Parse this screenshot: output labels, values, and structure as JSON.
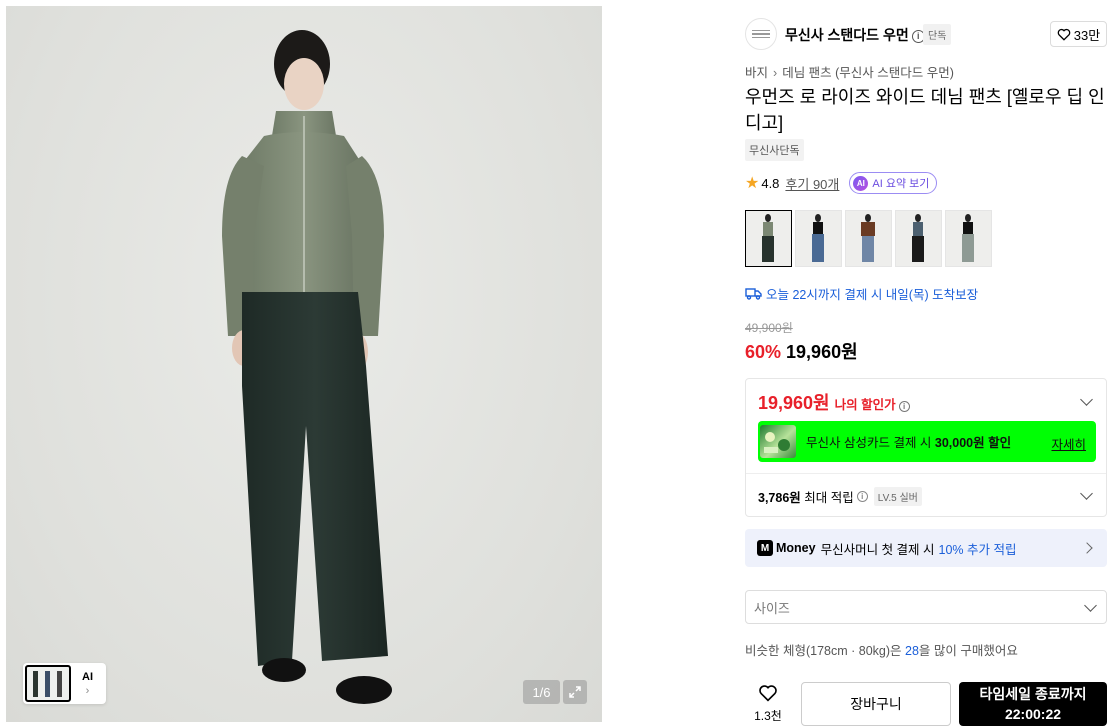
{
  "gallery": {
    "counter": "1/6",
    "ai_label": "AI"
  },
  "brand": {
    "name": "무신사 스탠다드 우먼",
    "badge": "단독",
    "like_count": "33만"
  },
  "breadcrumb": {
    "category": "바지",
    "subcategory": "데님 팬츠 (무신사 스탠다드 우먼)"
  },
  "product": {
    "title": "우먼즈 로 라이즈 와이드 데님 팬츠 [옐로우 딥 인디고]",
    "tag": "무신사단독",
    "rating": "4.8",
    "reviews": "후기 90개",
    "ai_summary": "AI 요약 보기",
    "delivery": "오늘 22시까지 결제 시 내일(목) 도착보장",
    "original_price": "49,900원",
    "discount": "60%",
    "sale_price": "19,960원"
  },
  "benefit": {
    "my_price": "19,960원",
    "my_price_label": "나의 할인가",
    "card_text_prefix": "무신사 삼성카드 결제 시 ",
    "card_text_bold": "30,000원 할인",
    "card_more": "자세히",
    "points_bold": "3,786원",
    "points_label": "최대 적립",
    "level": "LV.5 실버"
  },
  "money": {
    "word": "Money",
    "text": "무신사머니 첫 결제 시",
    "highlight": "10% 추가 적립"
  },
  "size": {
    "placeholder": "사이즈"
  },
  "body_hint": {
    "prefix": "비슷한 체형(178cm · 80kg)은 ",
    "size": "28",
    "suffix": "을 많이 구매했어요"
  },
  "actions": {
    "wish_count": "1.3천",
    "cart": "장바구니",
    "buy_line1": "타임세일 종료까지",
    "buy_line2": "22:00:22"
  },
  "colors": {
    "accent_red": "#e8202a",
    "link_blue": "#1b5fd9",
    "card_banner": "#00ff04",
    "star": "#f5a623"
  }
}
